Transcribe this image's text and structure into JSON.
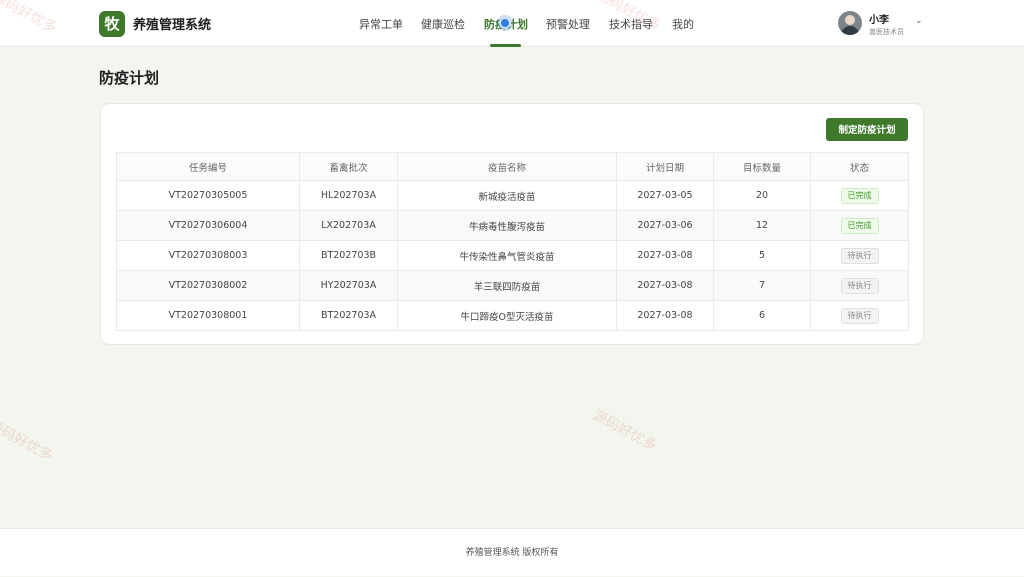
{
  "header": {
    "logo_char": "牧",
    "app_title": "养殖管理系统",
    "nav": [
      {
        "label": "异常工单",
        "active": false
      },
      {
        "label": "健康巡检",
        "active": false
      },
      {
        "label": "防疫计划",
        "active": true
      },
      {
        "label": "预警处理",
        "active": false
      },
      {
        "label": "技术指导",
        "active": false
      },
      {
        "label": "我的",
        "active": false
      }
    ],
    "user": {
      "name": "小李",
      "role": "兽医技术员",
      "dropdown_icon": "chevron-down-icon"
    }
  },
  "page": {
    "title": "防疫计划",
    "primary_action": "制定防疫计划"
  },
  "table": {
    "columns": [
      "任务编号",
      "畜禽批次",
      "疫苗名称",
      "计划日期",
      "目标数量",
      "状态"
    ],
    "rows": [
      {
        "id": "VT20270305005",
        "batch": "HL202703A",
        "vaccine": "新城疫活疫苗",
        "date": "2027-03-05",
        "qty": "20",
        "status": "已完成"
      },
      {
        "id": "VT20270306004",
        "batch": "LX202703A",
        "vaccine": "牛病毒性腹泻疫苗",
        "date": "2027-03-06",
        "qty": "12",
        "status": "已完成"
      },
      {
        "id": "VT20270308003",
        "batch": "BT202703B",
        "vaccine": "牛传染性鼻气管炎疫苗",
        "date": "2027-03-08",
        "qty": "5",
        "status": "待执行"
      },
      {
        "id": "VT20270308002",
        "batch": "HY202703A",
        "vaccine": "羊三联四防疫苗",
        "date": "2027-03-08",
        "qty": "7",
        "status": "待执行"
      },
      {
        "id": "VT20270308001",
        "batch": "BT202703A",
        "vaccine": "牛口蹄疫O型灭活疫苗",
        "date": "2027-03-08",
        "qty": "6",
        "status": "待执行"
      }
    ]
  },
  "footer": {
    "text": "养殖管理系统 版权所有"
  },
  "watermark": {
    "text": "源码好优多"
  },
  "colors": {
    "brand": "#3f7a2c",
    "done": "#3f9a2c",
    "pending": "#888888",
    "background": "#f2f6ee"
  }
}
